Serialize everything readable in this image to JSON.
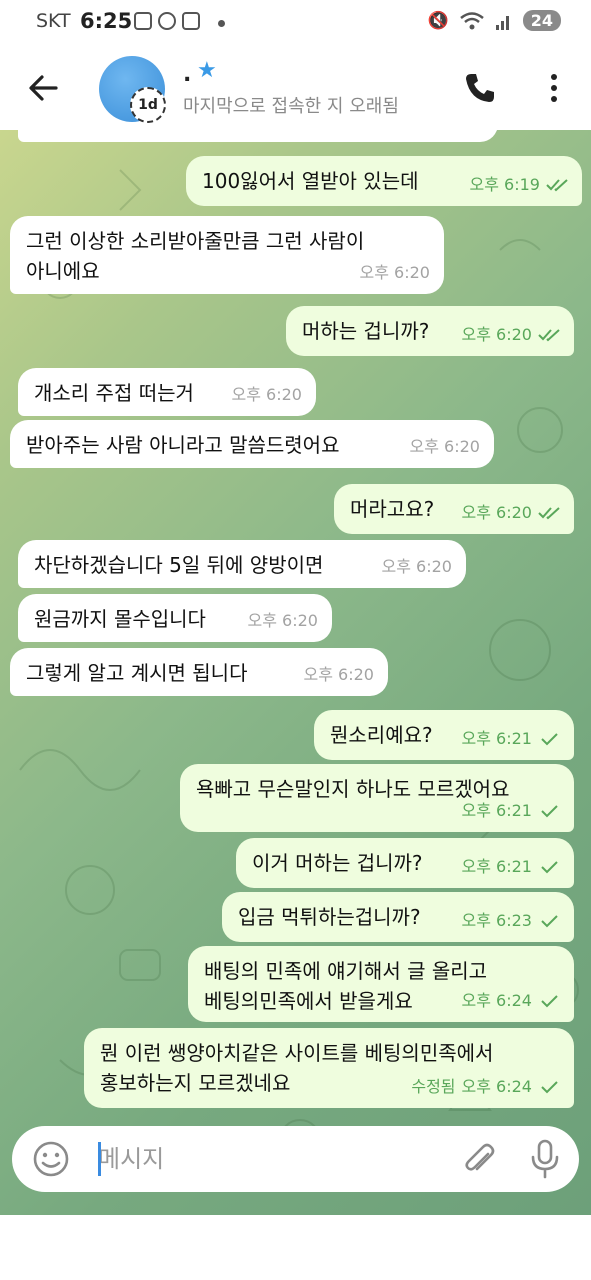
{
  "status_bar": {
    "carrier": "SKT",
    "time": "6:25",
    "battery": "24"
  },
  "header": {
    "contact_name": ".",
    "last_seen": "마지막으로 접속한 지 오래됨",
    "avatar_badge": "1d"
  },
  "messages": [
    {
      "dir": "out",
      "text": "100잃어서 열받아 있는데",
      "time": "오후 6:19",
      "status": "read"
    },
    {
      "dir": "in",
      "text": "그런 이상한 소리받아줄만큼 그런 사람이\n아니에요",
      "time": "오후 6:20"
    },
    {
      "dir": "out",
      "text": "머하는 겁니까?",
      "time": "오후 6:20",
      "status": "read"
    },
    {
      "dir": "in",
      "text": "개소리 주접 떠는거",
      "time": "오후 6:20"
    },
    {
      "dir": "in",
      "text": "받아주는 사람 아니라고 말씀드렷어요",
      "time": "오후 6:20"
    },
    {
      "dir": "out",
      "text": "머라고요?",
      "time": "오후 6:20",
      "status": "read"
    },
    {
      "dir": "in",
      "text": "차단하겠습니다 5일 뒤에 양방이면",
      "time": "오후 6:20"
    },
    {
      "dir": "in",
      "text": "원금까지 몰수입니다",
      "time": "오후 6:20"
    },
    {
      "dir": "in",
      "text": "그렇게 알고 계시면 됩니다",
      "time": "오후 6:20"
    },
    {
      "dir": "out",
      "text": "뭔소리예요?",
      "time": "오후 6:21",
      "status": "sent"
    },
    {
      "dir": "out",
      "text": "욕빠고 무슨말인지 하나도 모르겠어요",
      "time": "오후 6:21",
      "status": "sent"
    },
    {
      "dir": "out",
      "text": "이거 머하는 겁니까?",
      "time": "오후 6:21",
      "status": "sent"
    },
    {
      "dir": "out",
      "text": "입금 먹튀하는겁니까?",
      "time": "오후 6:23",
      "status": "sent"
    },
    {
      "dir": "out",
      "text": "배팅의 민족에 얘기해서 글 올리고\n베팅의민족에서 받을게요",
      "time": "오후 6:24",
      "status": "sent"
    },
    {
      "dir": "out",
      "text": "뭔 이런 쌩양아치같은 사이트를 베팅의민족에서\n홍보하는지 모르겠네요",
      "time": "오후 6:24",
      "edited": "수정됨",
      "status": "sent"
    }
  ],
  "composer": {
    "placeholder": "메시지"
  },
  "colors": {
    "incoming_bubble": "#ffffff",
    "outgoing_bubble": "#effdde",
    "outgoing_meta": "#59a75a",
    "accent": "#3a9ae6"
  }
}
